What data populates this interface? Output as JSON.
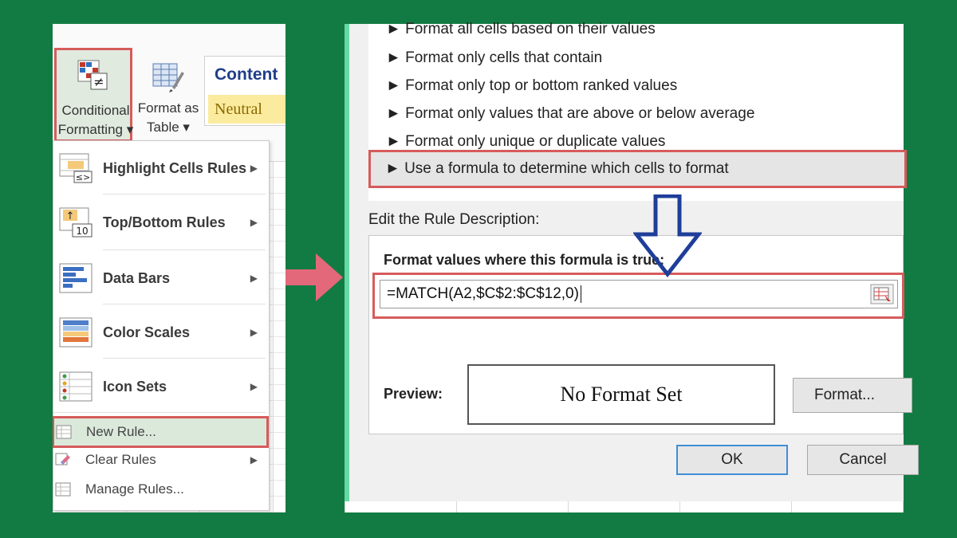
{
  "ribbon": {
    "conditional_formatting": {
      "line1": "Conditional",
      "line2": "Formatting ▾"
    },
    "format_as_table": {
      "line1": "Format as",
      "line2": "Table ▾"
    },
    "styles": {
      "content": "Content",
      "neutral": "Neutral"
    }
  },
  "menu": {
    "items": [
      {
        "label": "Highlight Cells Rules",
        "icon": "highlight-cells-icon"
      },
      {
        "label": "Top/Bottom Rules",
        "icon": "top-bottom-icon"
      },
      {
        "label": "Data Bars",
        "icon": "data-bars-icon"
      },
      {
        "label": "Color Scales",
        "icon": "color-scales-icon"
      },
      {
        "label": "Icon Sets",
        "icon": "icon-sets-icon"
      }
    ],
    "new_rule": "New Rule...",
    "clear_rules": "Clear Rules",
    "manage_rules": "Manage Rules..."
  },
  "dialog": {
    "rule_types": [
      "► Format all cells based on their values",
      "► Format only cells that contain",
      "► Format only top or bottom ranked values",
      "► Format only values that are above or below average",
      "► Format only unique or duplicate values"
    ],
    "selected_rule_type": "► Use a formula to determine which cells to format",
    "edit_description_label": "Edit the Rule Description:",
    "formula_label": "Format values where this formula is true:",
    "formula_value": "=MATCH(A2,$C$2:$C$12,0)",
    "preview_label": "Preview:",
    "preview_text": "No Format Set",
    "format_button": "Format...",
    "ok_button": "OK",
    "cancel_button": "Cancel"
  },
  "colors": {
    "background": "#127b43",
    "highlight_border": "#d75b5b",
    "dialog_frame": "#66d9a4",
    "annotation_arrow_blue": "#1f3e9a",
    "annotation_arrow_pink": "#e3687a"
  }
}
